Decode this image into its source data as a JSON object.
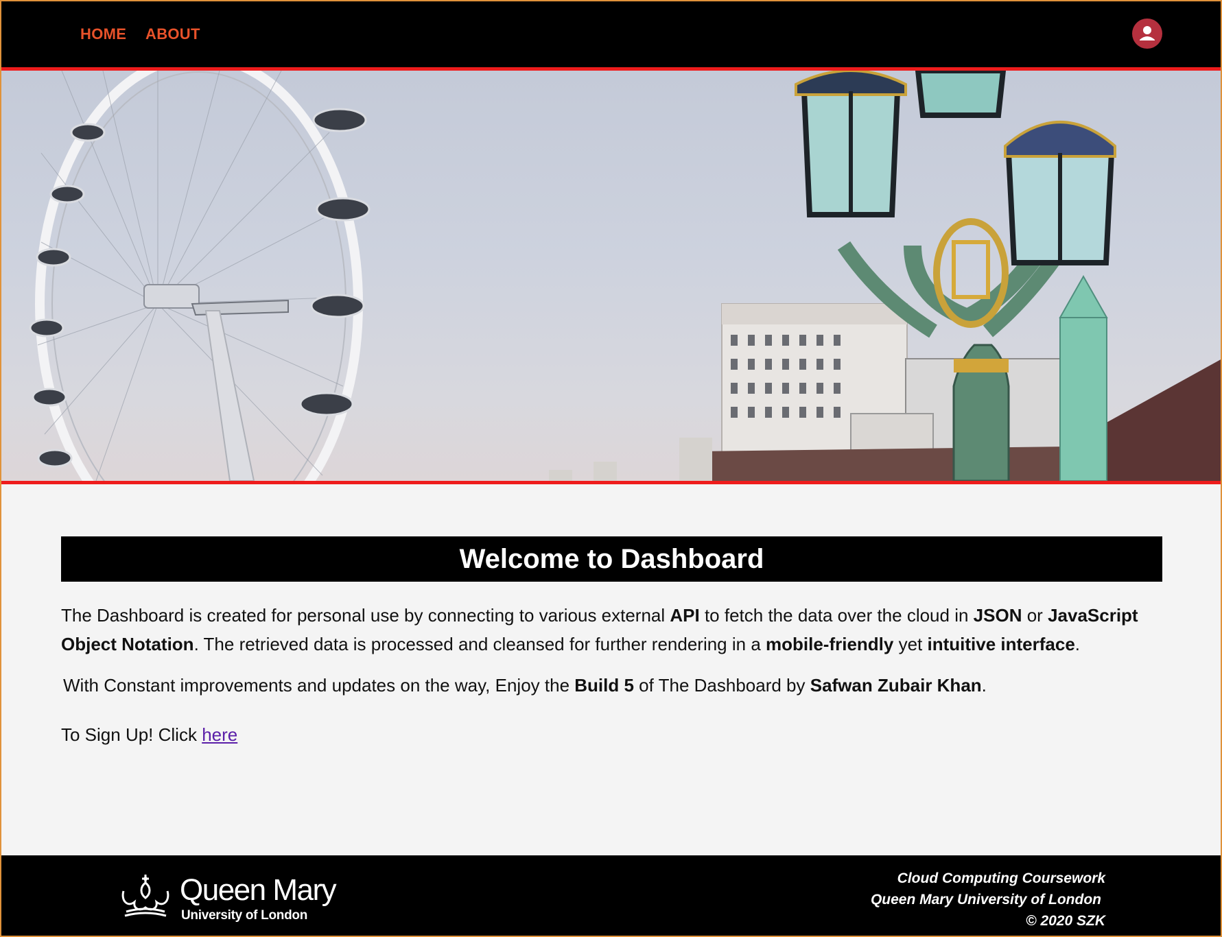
{
  "nav": {
    "home_label": "HOME",
    "about_label": "ABOUT",
    "accent_color": "#e8522a"
  },
  "hero": {
    "image_description": "London Eye and Westminster Bridge lamp posts",
    "border_color": "#ee1c1c"
  },
  "main": {
    "banner_title": "Welcome to Dashboard",
    "intro": {
      "t1": "The Dashboard is created for personal use by connecting to various external ",
      "b1": "API",
      "t2": " to fetch the data over the cloud in ",
      "b2": "JSON",
      "t3": " or ",
      "b3": "JavaScript Object Notation",
      "t4": ". The retrieved data is processed and cleansed for further rendering in a ",
      "b4": "mobile-friendly",
      "t5": " yet ",
      "b5": "intuitive interface",
      "t6": "."
    },
    "build": {
      "t1": "With Constant improvements and updates on the way, Enjoy the ",
      "b1": "Build 5",
      "t2": " of The Dashboard by ",
      "b2": "Safwan Zubair Khan",
      "t3": "."
    },
    "signup_text": "To Sign Up! Click ",
    "signup_link": "here"
  },
  "footer": {
    "logo_name": "Queen Mary",
    "logo_sub": "University of London",
    "credit_line1": "Cloud Computing Coursework",
    "credit_line2": "Queen Mary University of London",
    "credit_line3": "© 2020 SZK"
  }
}
